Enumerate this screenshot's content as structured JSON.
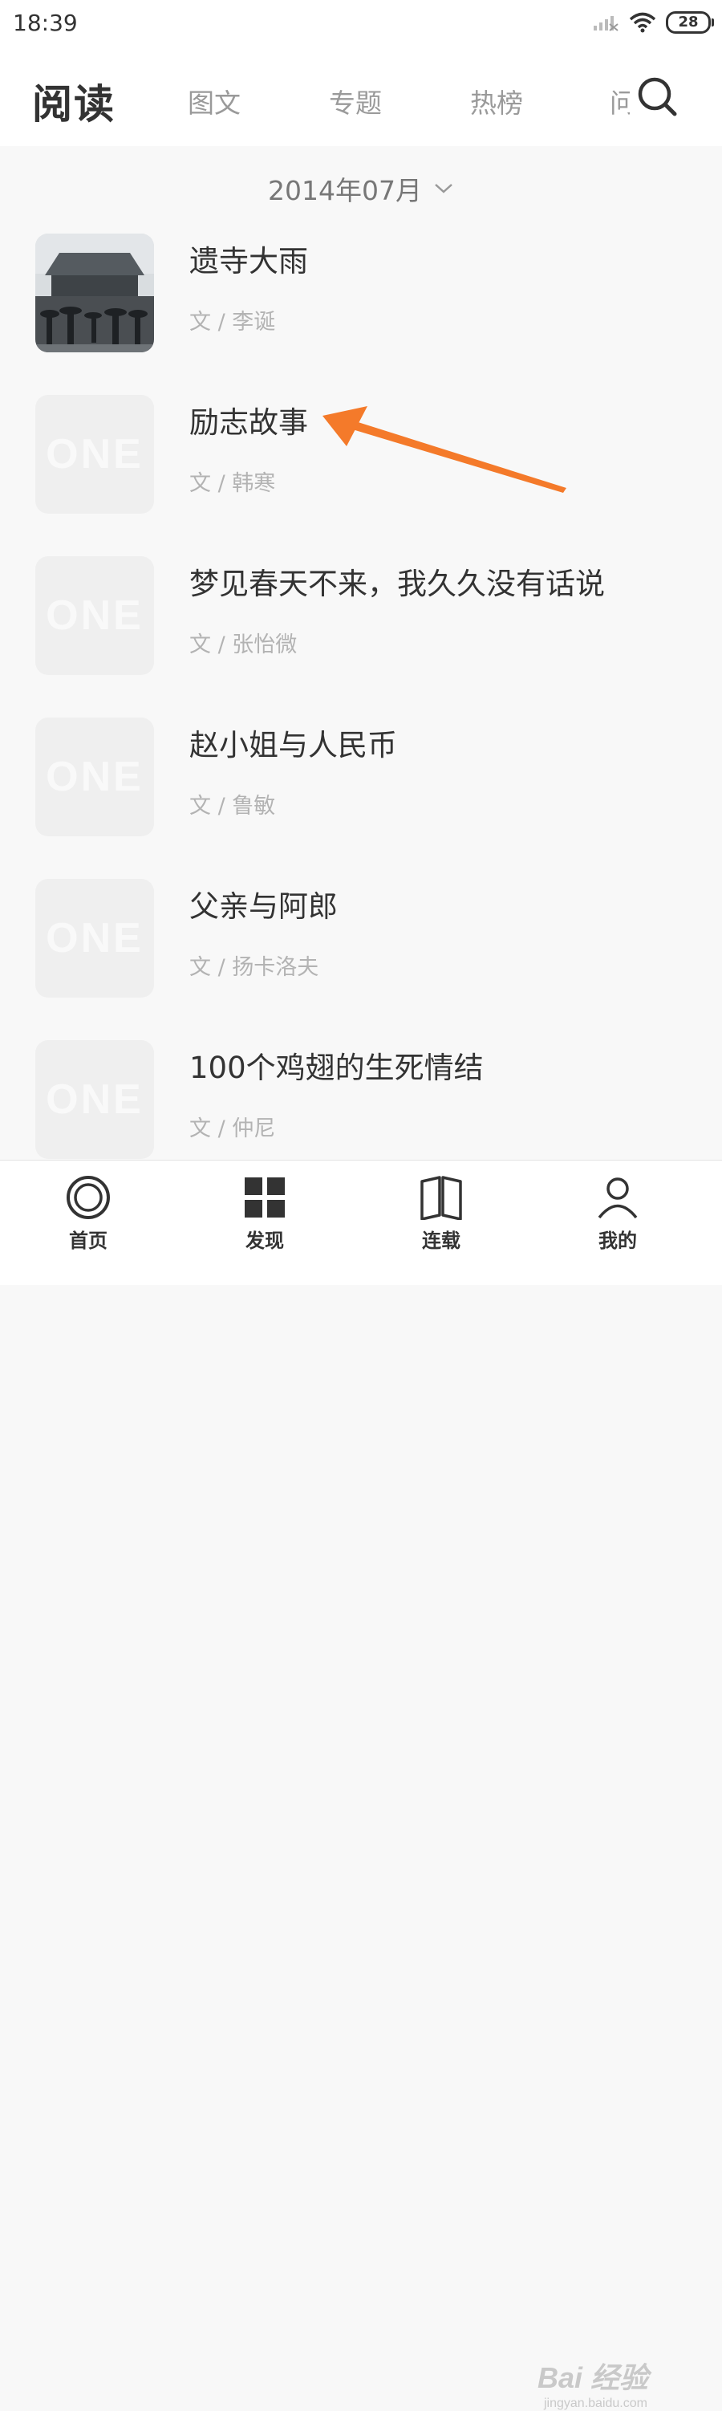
{
  "status_bar": {
    "time": "18:39",
    "battery": "28"
  },
  "header": {
    "title": "阅读",
    "tabs": [
      {
        "label": "图文"
      },
      {
        "label": "专题"
      },
      {
        "label": "热榜"
      },
      {
        "label": "问"
      }
    ]
  },
  "date_selector": {
    "label": "2014年07月"
  },
  "articles": [
    {
      "title": "遗寺大雨",
      "author": "文 / 李诞"
    },
    {
      "title": "励志故事",
      "author": "文 / 韩寒"
    },
    {
      "title": "梦见春天不来，我久久没有话说",
      "author": "文 / 张怡微"
    },
    {
      "title": "赵小姐与人民币",
      "author": "文 / 鲁敏"
    },
    {
      "title": "父亲与阿郎",
      "author": "文 / 扬卡洛夫"
    },
    {
      "title": "100个鸡翅的生死情结",
      "author": "文 / 仲尼"
    }
  ],
  "placeholder_logo": "ONE",
  "annotation": {
    "color": "#f47a2a"
  },
  "bottom_nav": [
    {
      "label": "首页"
    },
    {
      "label": "发现"
    },
    {
      "label": "连载"
    },
    {
      "label": "我的"
    }
  ],
  "watermark": {
    "main": "Bai 经验",
    "sub": "jingyan.baidu.com"
  }
}
